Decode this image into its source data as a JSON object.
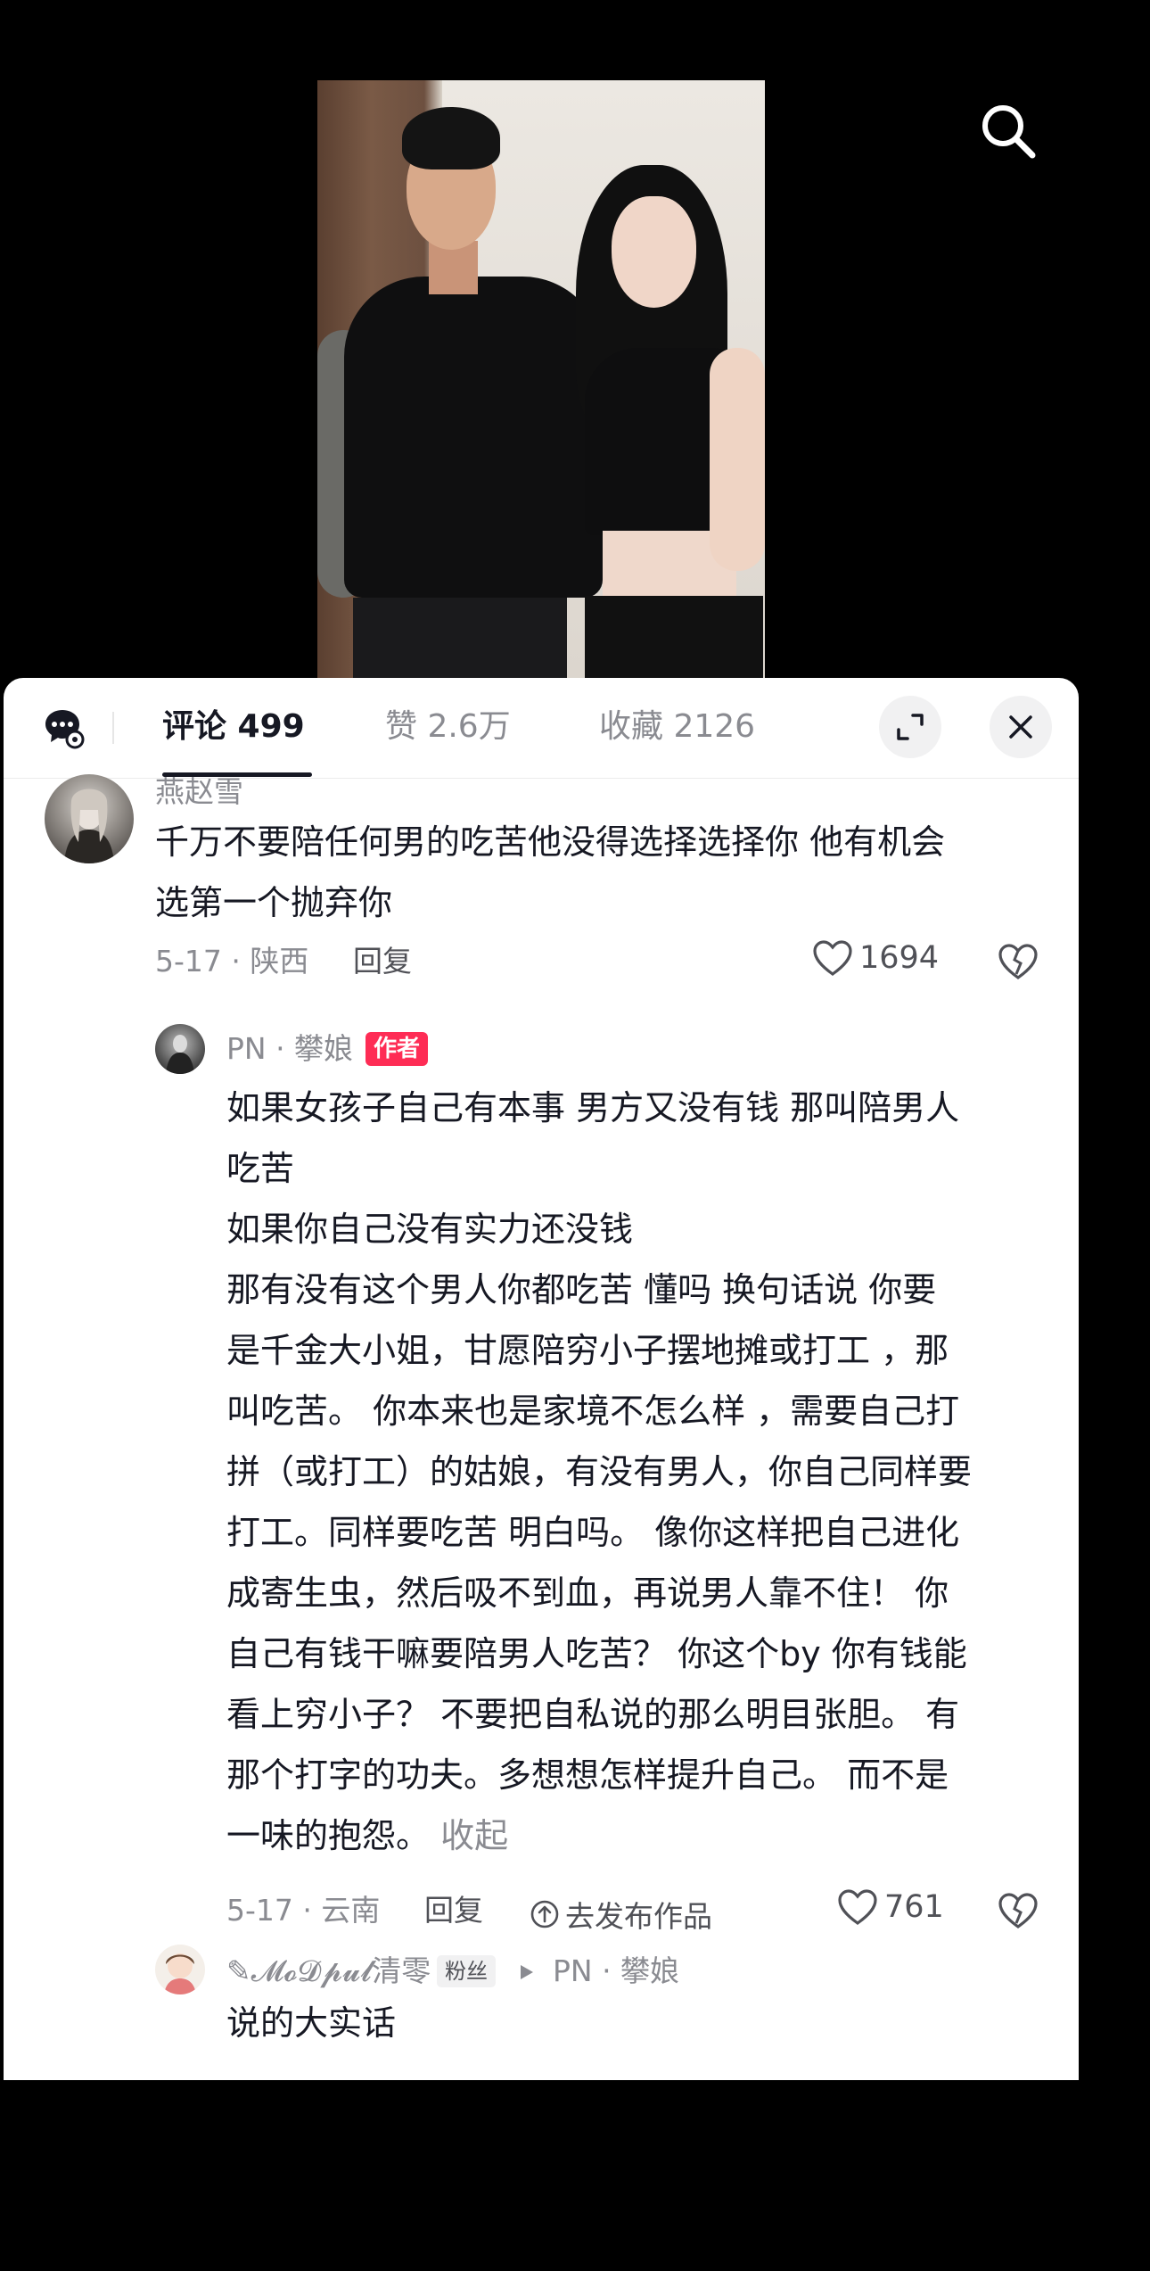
{
  "tabs": {
    "comments": "评论 499",
    "likes": "赞 2.6万",
    "favorites": "收藏 2126"
  },
  "comments": [
    {
      "username": "燕赵雪",
      "text_lines": [
        "千万不要陪任何男的吃苦他没得选择选择你 他有机会",
        "选第一个抛弃你"
      ],
      "meta": "5-17 · 陕西",
      "reply_label": "回复",
      "likes": "1694"
    }
  ],
  "reply1": {
    "username": "PN · 攀娘",
    "tag": "作者",
    "text_lines": [
      "如果女孩子自己有本事 男方又没有钱 那叫陪男人",
      "吃苦",
      "如果你自己没有实力还没钱",
      "那有没有这个男人你都吃苦 懂吗   换句话说 你要",
      "是千金大小姐，甘愿陪穷小子摆地摊或打工 ，那",
      "叫吃苦。 你本来也是家境不怎么样 ，需要自己打",
      "拼（或打工）的姑娘，有没有男人，你自己同样要",
      "打工。同样要吃苦 明白吗。 像你这样把自己进化",
      "成寄生虫，然后吸不到血，再说男人靠不住！   你",
      "自己有钱干嘛要陪男人吃苦？ 你这个by 你有钱能",
      "看上穷小子？ 不要把自私说的那么明目张胆。  有",
      "那个打字的功夫。多想想怎样提升自己。 而不是"
    ],
    "last_line": "一味的抱怨。",
    "collapse": "收起",
    "meta": "5-17 · 云南",
    "reply_label": "回复",
    "publish_label": "去发布作品",
    "likes": "761"
  },
  "reply2": {
    "username": "✎𝓜𝓸𝓓𝓹𝓾𝓵清零",
    "tag": "粉丝",
    "reply_to": "PN · 攀娘",
    "text": "说的大实话"
  },
  "icons": {
    "search": "search-icon",
    "comment_settings": "comment-settings-icon",
    "expand": "expand-icon",
    "close": "close-icon",
    "like": "heart-icon",
    "dislike": "broken-heart-icon",
    "publish": "upload-icon",
    "reply_arrow": "triangle-right-icon"
  },
  "colors": {
    "author_tag": "#fe2c55",
    "muted_text": "#8a8b91"
  }
}
